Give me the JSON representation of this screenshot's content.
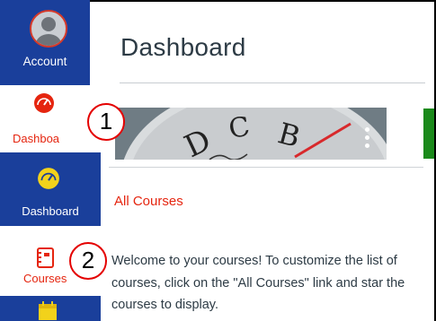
{
  "nav": {
    "account_label": "Account",
    "dashboard_partial_label": "Dashboa",
    "dashboard_label": "Dashboard",
    "courses_label": "Courses"
  },
  "main": {
    "title": "Dashboard",
    "card_letters": [
      "D",
      "C",
      "B"
    ],
    "all_courses_link": "All Courses",
    "welcome_text": "Welcome to your courses! To customize the list of courses, click on the \"All Courses\" link and star the courses to display."
  },
  "callouts": [
    "1",
    "2"
  ],
  "colors": {
    "nav_bg": "#1a3f9b",
    "accent_red": "#e5250f",
    "callout_red": "#e40000",
    "card_green": "#1b8a1b"
  },
  "icons": {
    "account": "avatar-icon",
    "dashboard": "speedometer-icon",
    "courses": "book-icon",
    "calendar": "calendar-icon",
    "card_menu": "vertical-ellipsis-icon"
  }
}
